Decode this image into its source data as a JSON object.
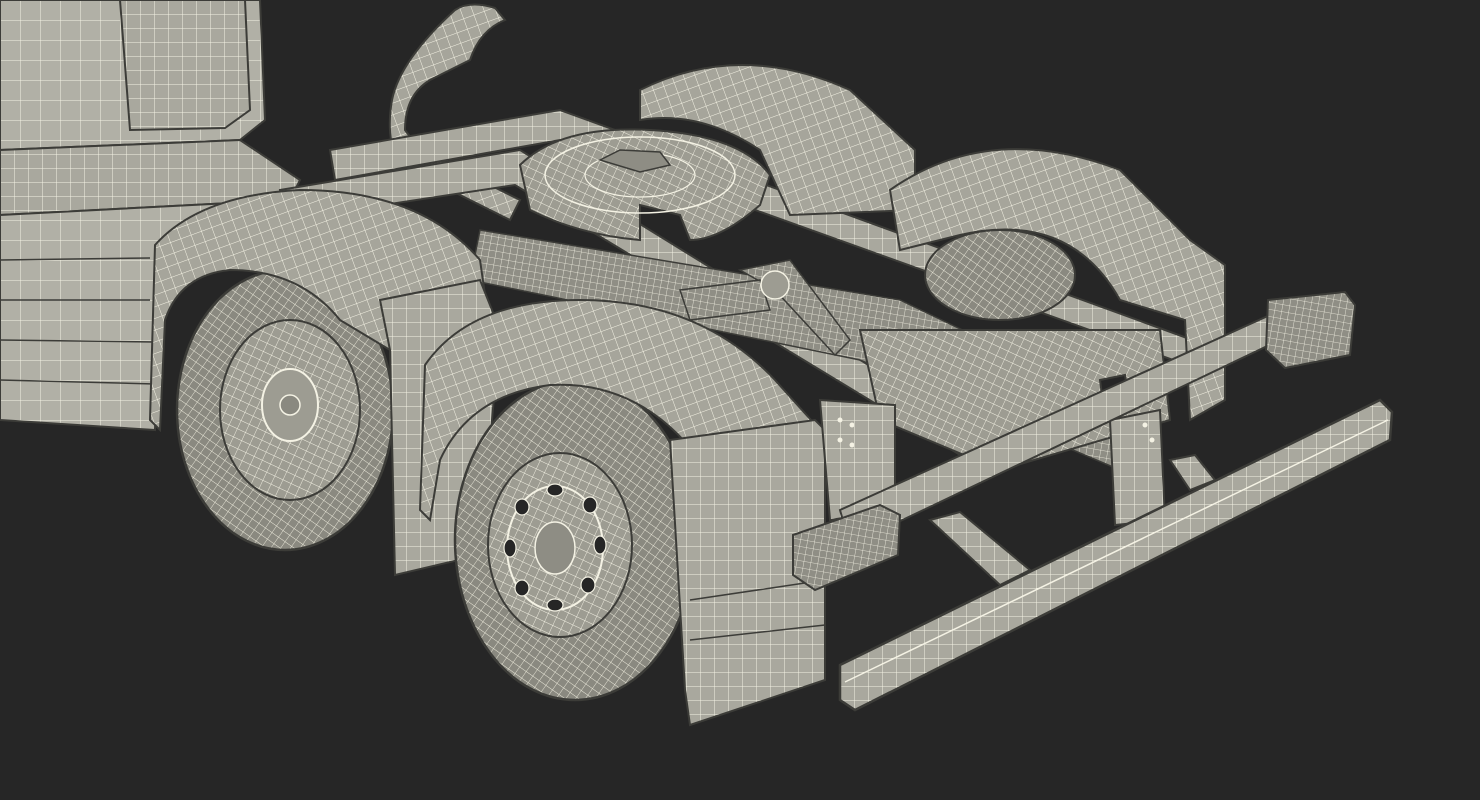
{
  "scene": {
    "background_color": "#262626",
    "surface_color": "#a9a89e",
    "surface_dark": "#8e8d84",
    "surface_light": "#bdbcb2",
    "wire_color": "#f4f2e4",
    "edge_color": "#3c3c38",
    "subject": "truck-chassis-wireframe"
  }
}
